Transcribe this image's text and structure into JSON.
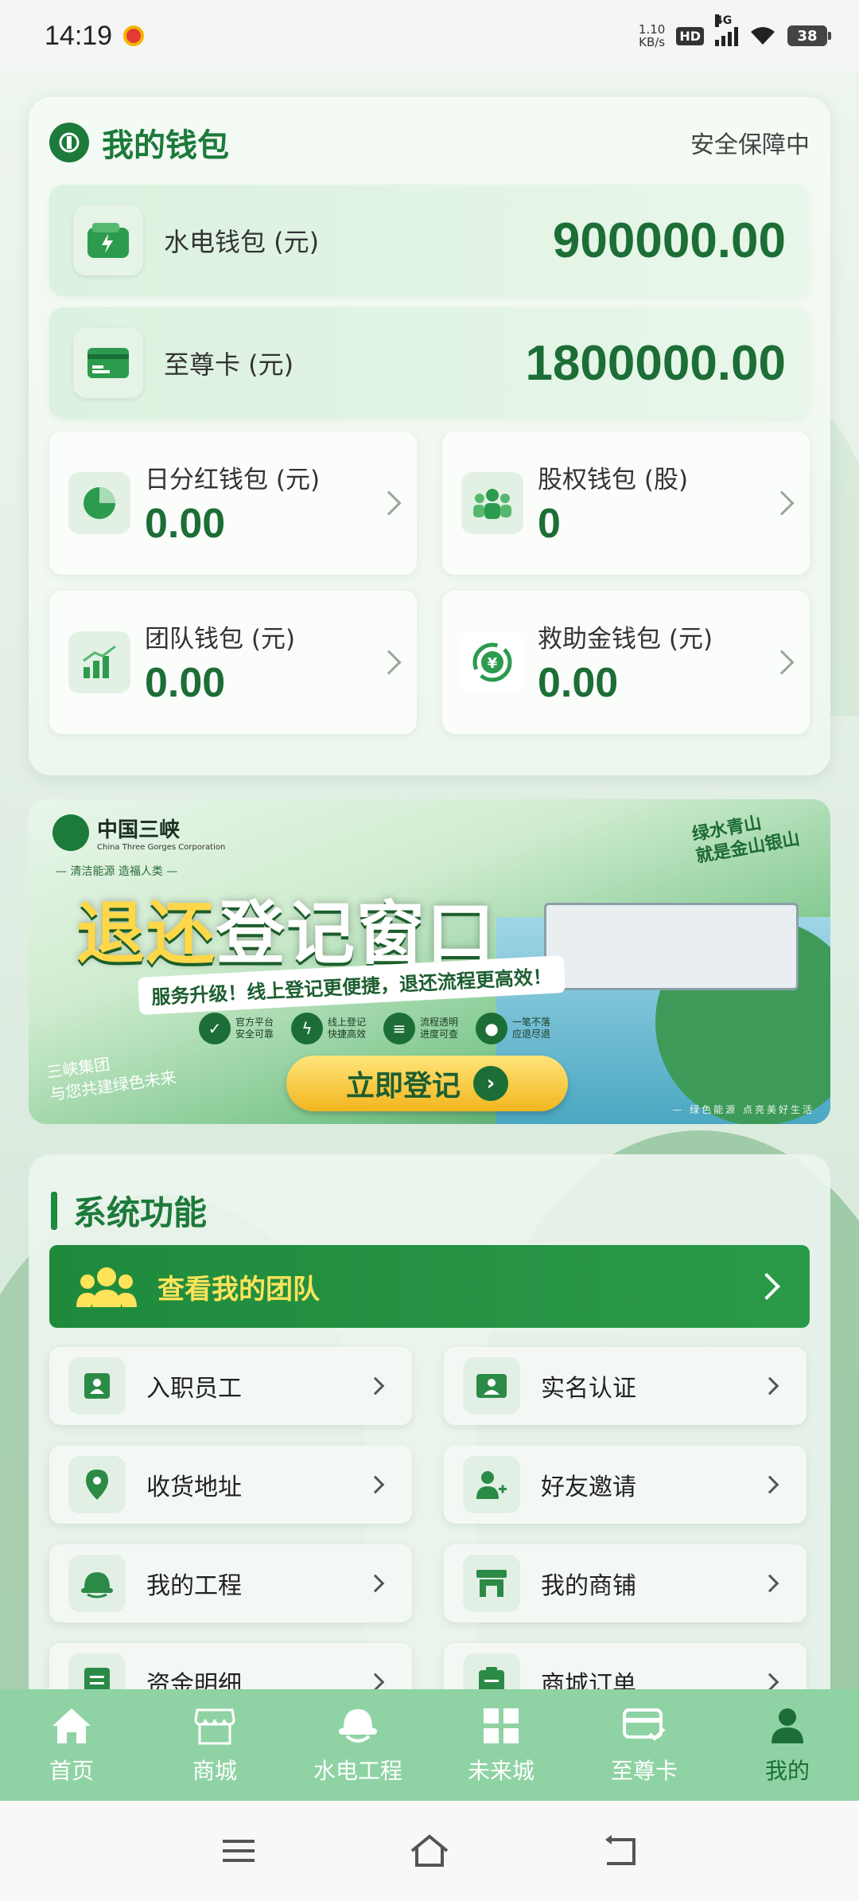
{
  "status_bar": {
    "time": "14:19",
    "net_speed_value": "1.10",
    "net_speed_unit": "KB/s",
    "hd": "HD",
    "network": "4G",
    "battery": "38"
  },
  "wallet": {
    "title": "我的钱包",
    "security": "安全保障中",
    "hydro_wallet": {
      "label": "水电钱包 (元)",
      "value": "900000.00"
    },
    "supreme_card": {
      "label": "至尊卡 (元)",
      "value": "1800000.00"
    },
    "tiles": [
      {
        "label": "日分红钱包 (元)",
        "value": "0.00",
        "icon": "pie-chart-icon"
      },
      {
        "label": "股权钱包 (股)",
        "value": "0",
        "icon": "people-group-icon"
      },
      {
        "label": "团队钱包 (元)",
        "value": "0.00",
        "icon": "bar-chart-icon"
      },
      {
        "label": "救助金钱包 (元)",
        "value": "0.00",
        "icon": "yen-cycle-icon"
      }
    ]
  },
  "banner": {
    "brand_name": "中国三峡",
    "brand_en": "China Three Gorges Corporation",
    "brand_slogan": "— 清洁能源 造福人类 —",
    "corner_slogan_1": "绿水青山",
    "corner_slogan_2": "就是金山银山",
    "title_part1": "退还",
    "title_part2": "登记窗口",
    "subtitle": "服务升级！线上登记更便捷，退还流程更高效！",
    "features": [
      {
        "line1": "官方平台",
        "line2": "安全可靠",
        "icon": "shield-check-icon"
      },
      {
        "line1": "线上登记",
        "line2": "快捷高效",
        "icon": "bolt-icon"
      },
      {
        "line1": "流程透明",
        "line2": "进度可查",
        "icon": "document-icon"
      },
      {
        "line1": "一笔不落",
        "line2": "应退尽退",
        "icon": "group-icon"
      }
    ],
    "cta": "立即登记",
    "left_slogan_1": "三峡集团",
    "left_slogan_2": "与您共建绿色未来",
    "bottom_slogan": "— 绿色能源 点亮美好生活"
  },
  "system": {
    "title": "系统功能",
    "team_button": "查看我的团队",
    "items": [
      {
        "label": "入职员工",
        "icon": "employee-badge-icon"
      },
      {
        "label": "实名认证",
        "icon": "id-card-icon"
      },
      {
        "label": "收货地址",
        "icon": "location-pin-icon"
      },
      {
        "label": "好友邀请",
        "icon": "add-friend-icon"
      },
      {
        "label": "我的工程",
        "icon": "hard-hat-icon"
      },
      {
        "label": "我的商铺",
        "icon": "store-icon"
      },
      {
        "label": "资金明细",
        "icon": "ledger-icon"
      },
      {
        "label": "商城订单",
        "icon": "clipboard-icon"
      }
    ]
  },
  "bottom_nav": [
    {
      "label": "首页",
      "icon": "home-icon"
    },
    {
      "label": "商城",
      "icon": "shop-icon"
    },
    {
      "label": "水电工程",
      "icon": "hard-hat-icon"
    },
    {
      "label": "未来城",
      "icon": "grid-icon"
    },
    {
      "label": "至尊卡",
      "icon": "card-check-icon"
    },
    {
      "label": "我的",
      "icon": "user-icon",
      "active": true
    }
  ],
  "colors": {
    "brand_green": "#1c7a3a",
    "value_green": "#1c6e36",
    "nav_bg": "#8fd3a4",
    "team_btn": "#1f8a3c",
    "team_label": "#ffe35a"
  }
}
